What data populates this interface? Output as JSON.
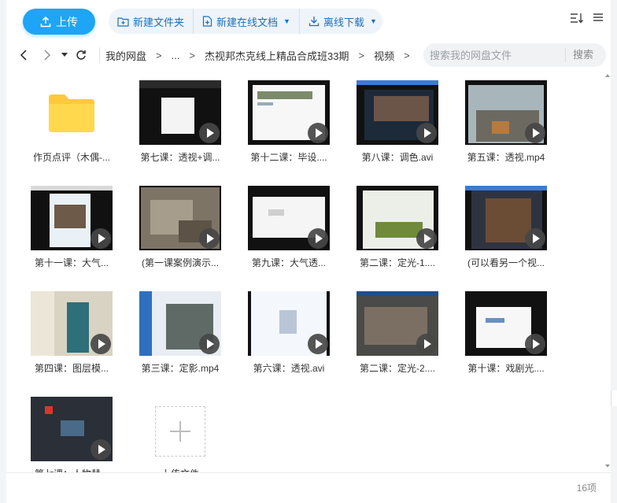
{
  "toolbar": {
    "upload_label": "上传",
    "new_folder_label": "新建文件夹",
    "new_doc_label": "新建在线文档",
    "offline_download_label": "离线下载"
  },
  "nav": {
    "crumbs": [
      "我的网盘",
      "...",
      "杰视邦杰克线上精品合成班33期",
      "视频"
    ],
    "search_placeholder": "搜索我的网盘文件",
    "search_button": "搜索"
  },
  "files": [
    {
      "name": "作页点评（木偶-...",
      "type": "folder"
    },
    {
      "name": "第七课：透视+调...",
      "type": "video"
    },
    {
      "name": "第十二课：毕设....",
      "type": "video"
    },
    {
      "name": "第八课：调色.avi",
      "type": "video"
    },
    {
      "name": "第五课：透视.mp4",
      "type": "video"
    },
    {
      "name": "第十一课：大气...",
      "type": "video"
    },
    {
      "name": "(第一课案例演示...",
      "type": "video"
    },
    {
      "name": "第九课：大气透...",
      "type": "video"
    },
    {
      "name": "第二课：定光-1....",
      "type": "video"
    },
    {
      "name": "(可以看另一个视...",
      "type": "video"
    },
    {
      "name": "第四课：图层模...",
      "type": "video"
    },
    {
      "name": "第三课：定影.mp4",
      "type": "video"
    },
    {
      "name": "第六课：透视.avi",
      "type": "video"
    },
    {
      "name": "第二课：定光-2....",
      "type": "video"
    },
    {
      "name": "第十课：戏剧光....",
      "type": "video"
    },
    {
      "name": "第七课：人物替...",
      "type": "video"
    },
    {
      "name": "上传文件",
      "type": "upload"
    }
  ],
  "status": {
    "count": "16项"
  },
  "colors": {
    "accent": "#1ea5f5",
    "folder": "#ffd13a",
    "link": "#1f6fb7"
  }
}
